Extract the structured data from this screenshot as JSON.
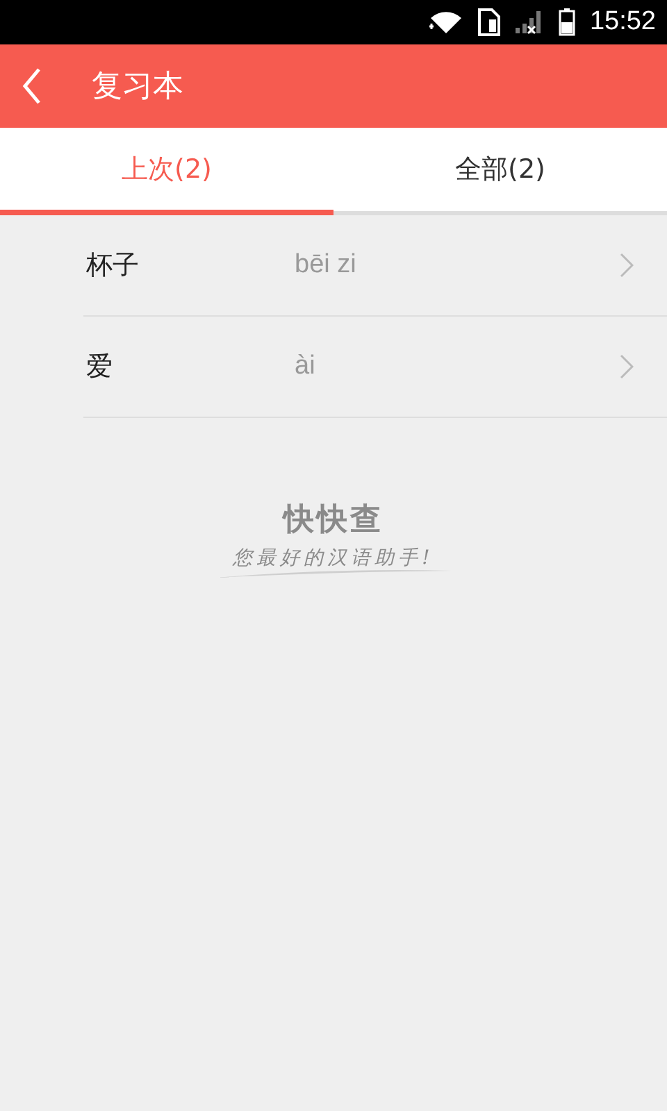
{
  "status_bar": {
    "time": "15:52"
  },
  "header": {
    "title": "复习本"
  },
  "tabs": [
    {
      "label": "上次(2)",
      "selected": true
    },
    {
      "label": "全部(2)",
      "selected": false
    }
  ],
  "words": [
    {
      "word": "杯子",
      "pinyin": "bēi zi"
    },
    {
      "word": "爱",
      "pinyin": "ài"
    }
  ],
  "brand": {
    "name": "快快查",
    "slogan": "您最好的汉语助手!"
  }
}
